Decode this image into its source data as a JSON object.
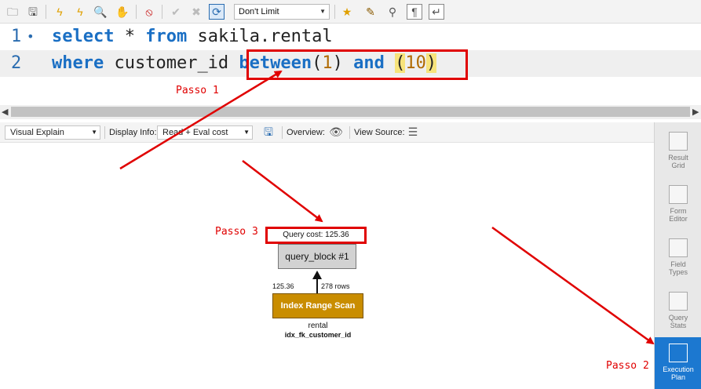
{
  "toolbar": {
    "limit_select": "Don't Limit",
    "icons": [
      "open-folder-icon",
      "save-icon",
      "execute-icon",
      "execute-current-icon",
      "explain-icon",
      "stop-icon",
      "toggle-continue-icon",
      "commit-icon",
      "rollback-icon",
      "autocommit-icon",
      "bookmark-star-icon",
      "beautify-icon",
      "find-icon",
      "invisible-chars-icon",
      "wrap-icon"
    ]
  },
  "editor": {
    "line1": {
      "num": "1",
      "dot": "•",
      "kw1": "select",
      "rest1": " * ",
      "kw2": "from",
      "rest2": " sakila.rental"
    },
    "line2": {
      "num": "2",
      "kw1": "where",
      "rest1": " customer_id ",
      "kw2": "between",
      "p1": "(",
      "n1": "1",
      "p2": ")",
      "sp": " ",
      "kw3": "and",
      "sp2": " ",
      "p3": "(",
      "n2": "10",
      "p4": ")"
    }
  },
  "explain_bar": {
    "view_select": "Visual Explain",
    "display_label": "Display Info:",
    "display_select": "Read + Eval cost",
    "overview_label": "Overview:",
    "view_source_label": "View Source:"
  },
  "diagram": {
    "query_cost": "Query cost: 125.36",
    "query_block": "query_block #1",
    "left_cost": "125.36",
    "rows": "278 rows",
    "scan_label": "Index Range Scan",
    "table": "rental",
    "key": "idx_fk_customer_id"
  },
  "side": [
    {
      "label1": "Result",
      "label2": "Grid"
    },
    {
      "label1": "Form",
      "label2": "Editor"
    },
    {
      "label1": "Field",
      "label2": "Types"
    },
    {
      "label1": "Query",
      "label2": "Stats"
    },
    {
      "label1": "Execution",
      "label2": "Plan"
    }
  ],
  "annotations": {
    "passo1": "Passo 1",
    "passo2": "Passo 2",
    "passo3": "Passo 3"
  },
  "colors": {
    "accent": "#1c78d0",
    "annotation": "#e00000",
    "scan": "#c98d00"
  }
}
